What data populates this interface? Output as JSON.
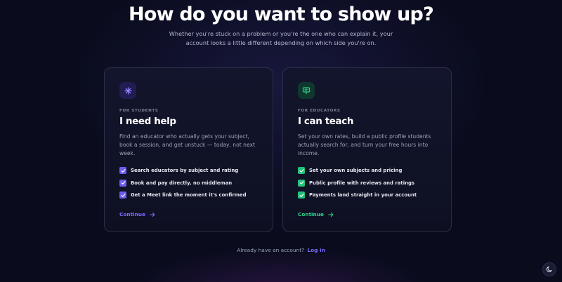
{
  "hero": {
    "title": "How do you want to show up?",
    "subtitle": "Whether you're stuck on a problem or you're the one who can explain it, your account looks a little different depending on which side you're on."
  },
  "cards": [
    {
      "eyebrow": "FOR STUDENTS",
      "title": "I need help",
      "description": "Find an educator who actually gets your subject, book a session, and get unstuck — today, not next week.",
      "icon": "sparkle-icon",
      "accent": "#6c5cf0",
      "features": [
        "Search educators by subject and rating",
        "Book and pay directly, no middleman",
        "Get a Meet link the moment it's confirmed"
      ],
      "cta": "Continue"
    },
    {
      "eyebrow": "FOR EDUCATORS",
      "title": "I can teach",
      "description": "Set your own rates, build a public profile students actually search for, and turn your free hours into income.",
      "icon": "presentation-icon",
      "accent": "#22c07a",
      "features": [
        "Set your own subjects and pricing",
        "Public profile with reviews and ratings",
        "Payments land straight in your account"
      ],
      "cta": "Continue"
    }
  ],
  "footer": {
    "prompt": "Already have an account?",
    "login_label": "Log in"
  },
  "theme_toggle": {
    "icon": "moon-icon"
  },
  "colors": {
    "background": "#0a0c1e",
    "student_accent": "#6c5cf0",
    "educator_accent": "#22c07a"
  }
}
